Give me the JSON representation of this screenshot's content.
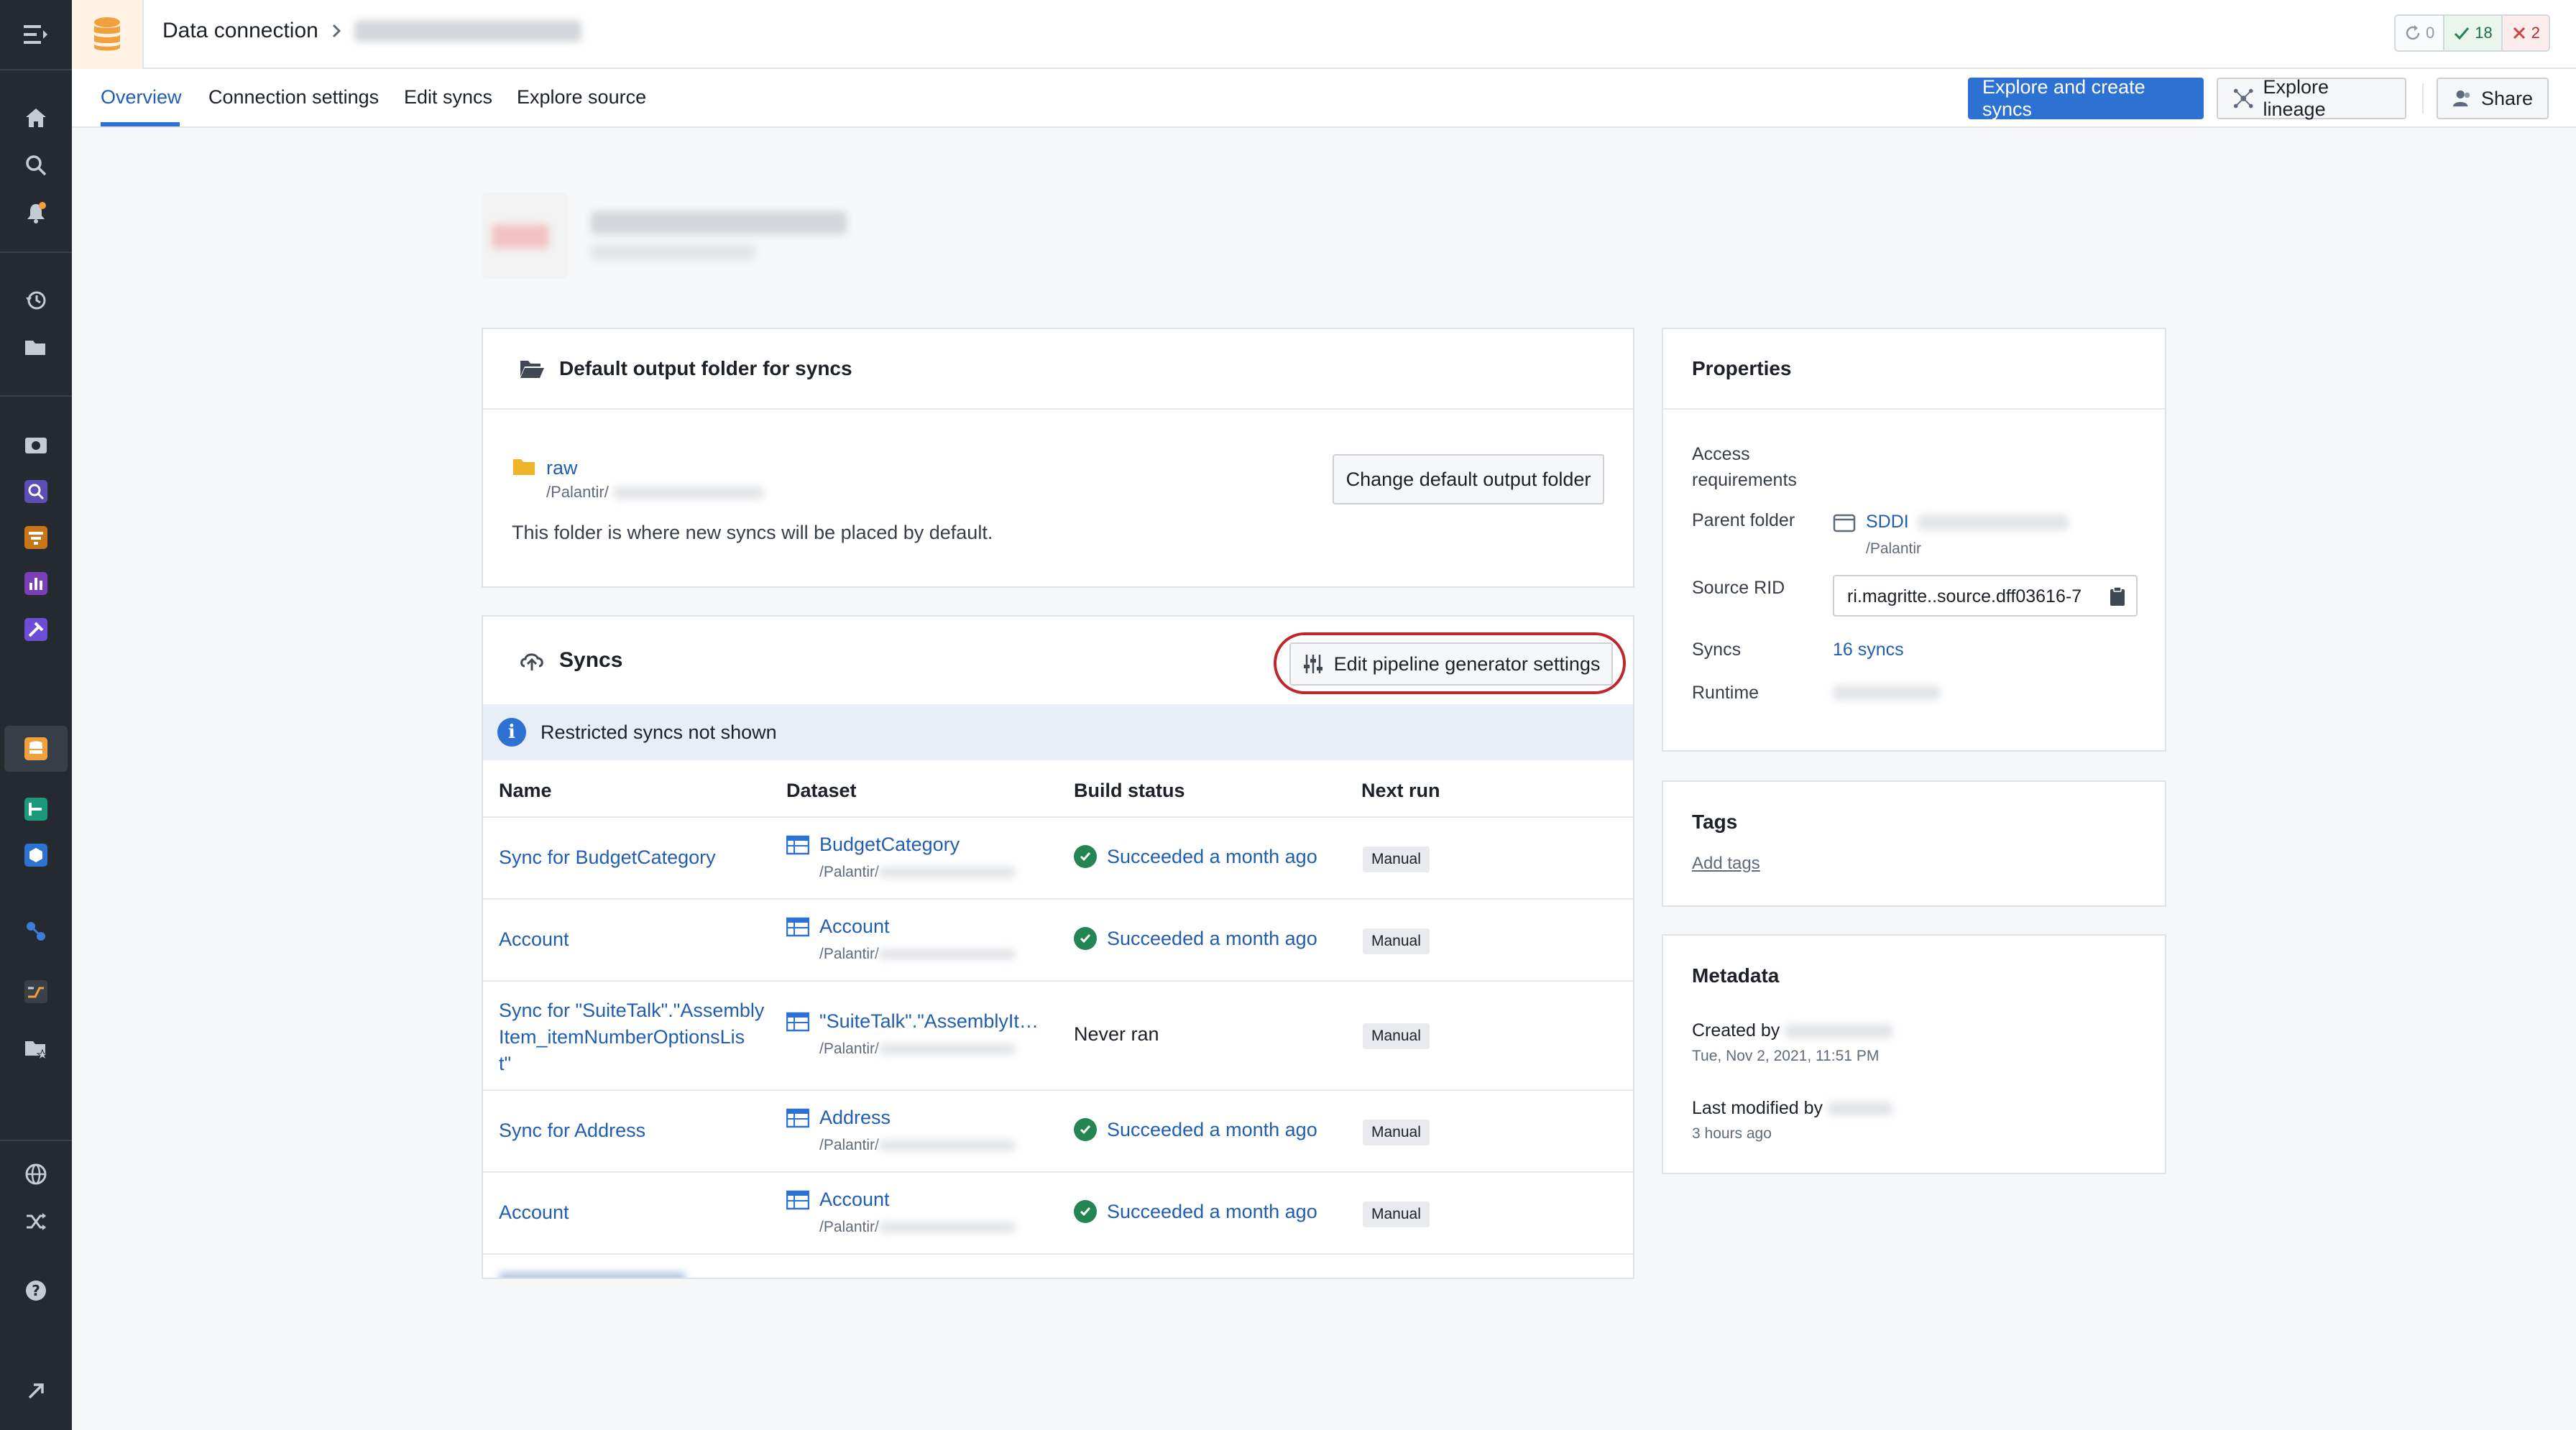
{
  "header": {
    "app_title": "Data connection",
    "status": {
      "running": "0",
      "succeeded": "18",
      "failed": "2"
    }
  },
  "tabs": [
    {
      "label": "Overview"
    },
    {
      "label": "Connection settings"
    },
    {
      "label": "Edit syncs"
    },
    {
      "label": "Explore source"
    }
  ],
  "actions": {
    "explore_create": "Explore and create syncs",
    "explore_lineage": "Explore lineage",
    "share": "Share"
  },
  "output_folder": {
    "title": "Default output folder for syncs",
    "folder_name": "raw",
    "folder_path": "/Palantir/",
    "description": "This folder is where new syncs will be placed by default.",
    "change_button": "Change default output folder"
  },
  "syncs": {
    "title": "Syncs",
    "edit_button": "Edit pipeline generator settings",
    "notice": "Restricted syncs not shown",
    "columns": {
      "name": "Name",
      "dataset": "Dataset",
      "build_status": "Build status",
      "next_run": "Next run"
    },
    "rows": [
      {
        "name": "Sync for BudgetCategory",
        "dataset": "BudgetCategory",
        "path": "/Palantir/",
        "status": "Succeeded a month ago",
        "next": "Manual"
      },
      {
        "name": "Account",
        "dataset": "Account",
        "path": "/Palantir/",
        "status": "Succeeded a month ago",
        "next": "Manual"
      },
      {
        "name_l1": "Sync for \"SuiteTalk\".\"Assembly",
        "name_l2": "Item_itemNumberOptionsLis",
        "name_l3": "t\"",
        "dataset": "\"SuiteTalk\".\"AssemblyIt…",
        "path": "/Palantir/",
        "status": "Never ran",
        "next": "Manual"
      },
      {
        "name": "Sync for Address",
        "dataset": "Address",
        "path": "/Palantir/",
        "status": "Succeeded a month ago",
        "next": "Manual"
      },
      {
        "name": "Account",
        "dataset": "Account",
        "path": "/Palantir/",
        "status": "Succeeded a month ago",
        "next": "Manual"
      }
    ]
  },
  "properties": {
    "title": "Properties",
    "access_l1": "Access",
    "access_l2": "requirements",
    "parent_folder_label": "Parent folder",
    "parent_folder_value": "SDDI",
    "parent_folder_path": "/Palantir",
    "source_rid_label": "Source RID",
    "source_rid_value": "ri.magritte..source.dff03616-7",
    "syncs_label": "Syncs",
    "syncs_value": "16 syncs",
    "runtime_label": "Runtime"
  },
  "tags": {
    "title": "Tags",
    "add": "Add tags"
  },
  "metadata": {
    "title": "Metadata",
    "created_by_label": "Created by",
    "created_date": "Tue, Nov 2, 2021, 11:51 PM",
    "modified_by_label": "Last modified by",
    "modified_ago": "3 hours ago"
  },
  "colors": {
    "accent": "#2d72d2",
    "link": "#215db0",
    "success": "#238551",
    "danger": "#cd4246",
    "highlight": "#c0272d",
    "db_orange": "#f0a03c"
  }
}
